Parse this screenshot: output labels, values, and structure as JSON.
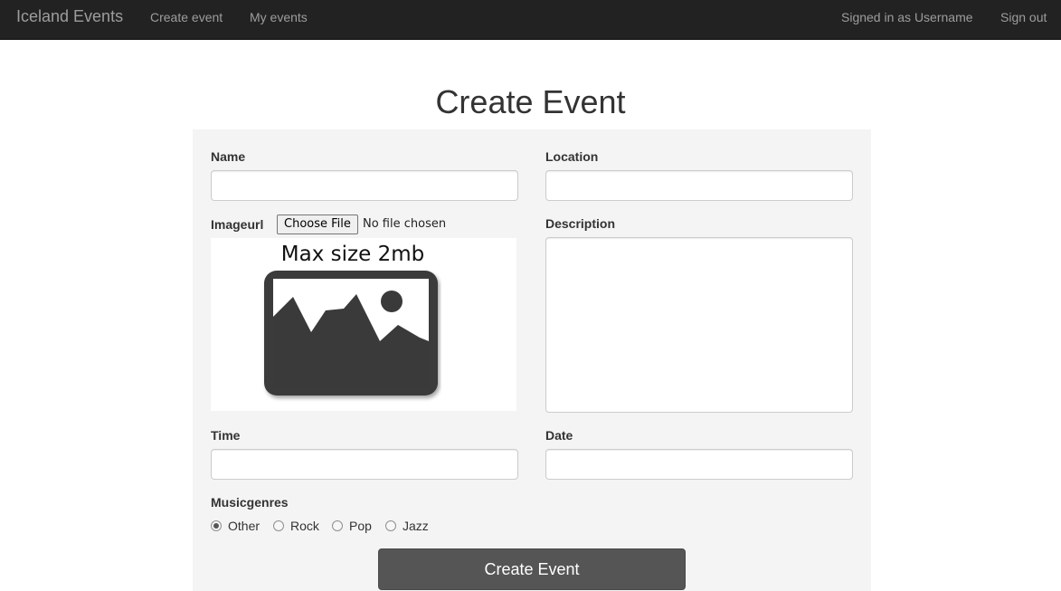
{
  "navbar": {
    "brand": "Iceland Events",
    "links": [
      {
        "label": "Create event"
      },
      {
        "label": "My events"
      }
    ],
    "signed_in": "Signed in as Username",
    "sign_out": "Sign out"
  },
  "page": {
    "title": "Create Event"
  },
  "form": {
    "name_label": "Name",
    "name_value": "",
    "location_label": "Location",
    "location_value": "",
    "imageurl_label": "Imageurl",
    "file_button": "Choose File",
    "file_status": "No file chosen",
    "preview_caption": "Max size 2mb",
    "description_label": "Description",
    "description_value": "",
    "time_label": "Time",
    "time_value": "",
    "date_label": "Date",
    "date_value": "",
    "musicgenres_label": "Musicgenres",
    "genres": [
      {
        "label": "Other",
        "checked": true
      },
      {
        "label": "Rock",
        "checked": false
      },
      {
        "label": "Pop",
        "checked": false
      },
      {
        "label": "Jazz",
        "checked": false
      }
    ],
    "submit_label": "Create Event"
  },
  "colors": {
    "navbar_bg": "#222222",
    "nav_text": "#9d9d9d",
    "panel_bg": "#f4f4f4",
    "button_bg": "#555555",
    "placeholder_icon": "#3a3a3a"
  },
  "icons": {
    "preview": "image-placeholder-icon"
  }
}
